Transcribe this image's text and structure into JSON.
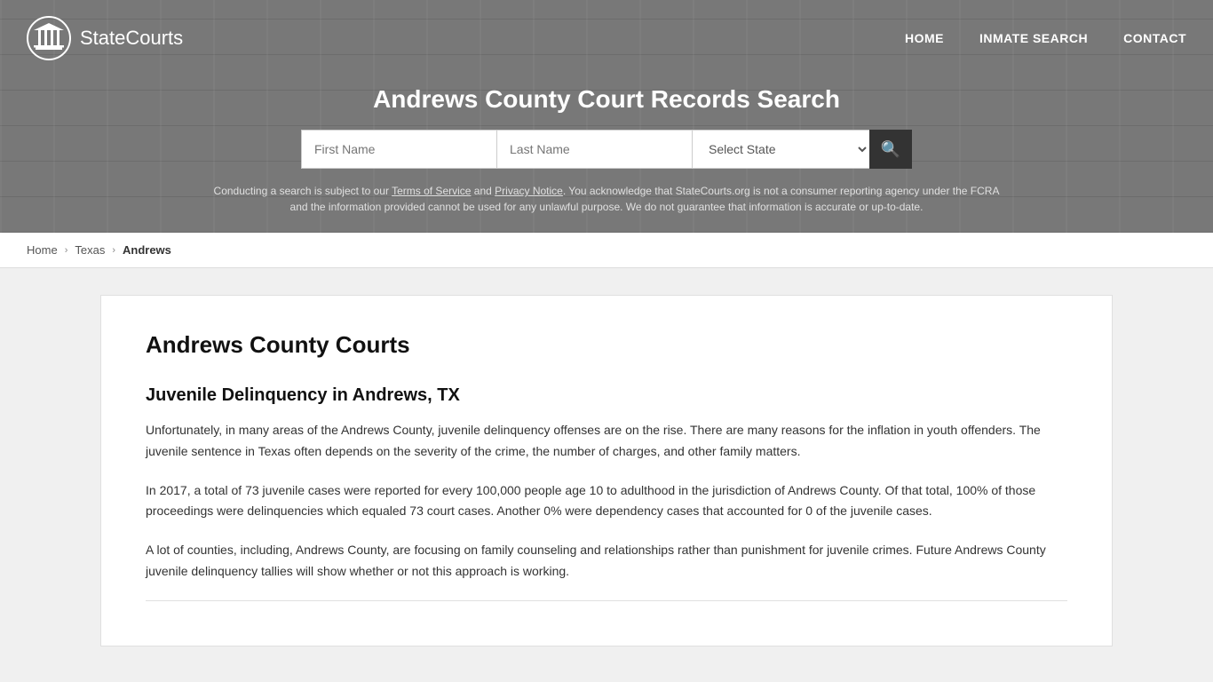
{
  "site": {
    "name": "StateCourts"
  },
  "nav": {
    "home_label": "HOME",
    "inmate_search_label": "INMATE SEARCH",
    "contact_label": "CONTACT"
  },
  "header": {
    "page_title": "Andrews County Court Records Search",
    "first_name_placeholder": "First Name",
    "last_name_placeholder": "Last Name",
    "state_select_label": "Select State",
    "disclaimer": "Conducting a search is subject to our Terms of Service and Privacy Notice. You acknowledge that StateCourts.org is not a consumer reporting agency under the FCRA and the information provided cannot be used for any unlawful purpose. We do not guarantee that information is accurate or up-to-date.",
    "terms_label": "Terms of Service",
    "privacy_label": "Privacy Notice"
  },
  "breadcrumb": {
    "home": "Home",
    "state": "Texas",
    "county": "Andrews"
  },
  "content": {
    "main_title": "Andrews County Courts",
    "section1_title": "Juvenile Delinquency in Andrews, TX",
    "para1": "Unfortunately, in many areas of the Andrews County, juvenile delinquency offenses are on the rise. There are many reasons for the inflation in youth offenders. The juvenile sentence in Texas often depends on the severity of the crime, the number of charges, and other family matters.",
    "para2": "In 2017, a total of 73 juvenile cases were reported for every 100,000 people age 10 to adulthood in the jurisdiction of Andrews County. Of that total, 100% of those proceedings were delinquencies which equaled 73 court cases. Another 0% were dependency cases that accounted for 0 of the juvenile cases.",
    "para3": "A lot of counties, including, Andrews County, are focusing on family counseling and relationships rather than punishment for juvenile crimes. Future Andrews County juvenile delinquency tallies will show whether or not this approach is working."
  },
  "icons": {
    "search": "🔍",
    "chevron": "›"
  }
}
